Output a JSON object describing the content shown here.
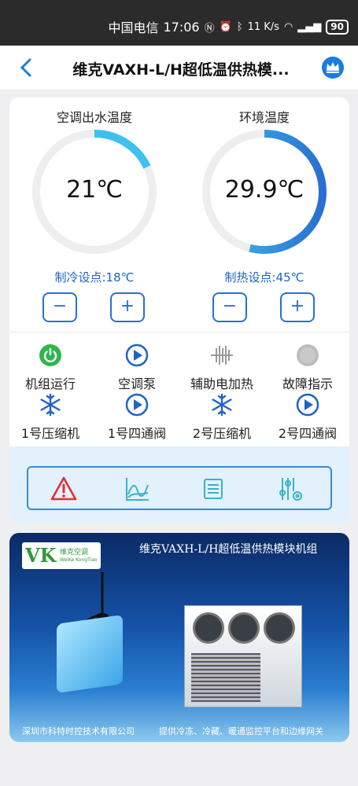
{
  "status": {
    "carrier": "中国电信",
    "time": "17:06",
    "net_speed": "11 K/s",
    "battery": "90"
  },
  "header": {
    "title": "维克VAXH-L/H超低温供热模..."
  },
  "gauges": [
    {
      "title": "空调出水温度",
      "value": "21℃",
      "setpoint": "制冷设点:18℃",
      "fill": 0.18
    },
    {
      "title": "环境温度",
      "value": "29.9℃",
      "setpoint": "制热设点:45℃",
      "fill": 0.54
    }
  ],
  "steppers": {
    "minus": "−",
    "plus": "+"
  },
  "indicators": [
    {
      "label": "机组运行",
      "icon": "power-icon",
      "color": "#2fb64c"
    },
    {
      "label": "空调泵",
      "icon": "pump-icon",
      "color": "#1f63c8"
    },
    {
      "label": "辅助电加热",
      "icon": "heater-icon",
      "color": "#9a9a9a"
    },
    {
      "label": "故障指示",
      "icon": "fault-indicator-icon",
      "color": "#bdbdbd"
    },
    {
      "label": "1号压缩机",
      "icon": "compressor-icon",
      "color": "#1f63c8"
    },
    {
      "label": "1号四通阀",
      "icon": "valve-icon",
      "color": "#1f63c8"
    },
    {
      "label": "2号压缩机",
      "icon": "compressor-icon",
      "color": "#1f63c8"
    },
    {
      "label": "2号四通阀",
      "icon": "valve-icon",
      "color": "#1f63c8"
    }
  ],
  "toolbar": [
    "alarm-icon",
    "chart-icon",
    "list-icon",
    "settings-sliders-icon"
  ],
  "banner": {
    "logo_text": "VK",
    "logo_cn": "维克空调",
    "logo_en": "WeiKe KongTiao",
    "title": "维克VAXH-L/H超低温供热模块机组",
    "footer_left": "深圳市科特时控技术有限公司",
    "footer_right": "提供冷冻、冷藏、暖通监控平台和边缘网关"
  },
  "colors": {
    "accent": "#1f63c8",
    "gauge_fill": "#3ec1ee",
    "gauge_track": "#eeeeee"
  }
}
